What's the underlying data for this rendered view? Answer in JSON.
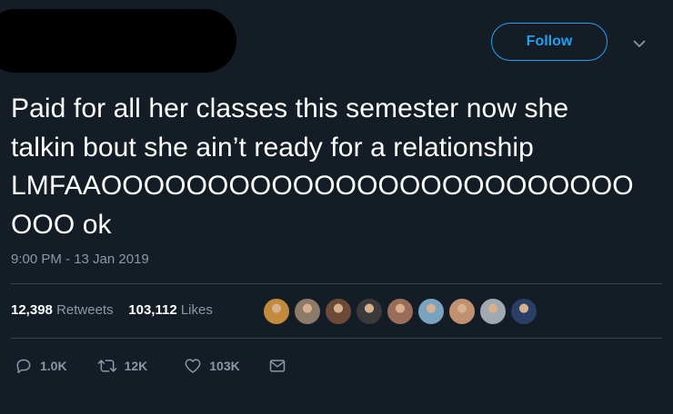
{
  "header": {
    "follow_label": "Follow"
  },
  "tweet": {
    "lines": [
      "Paid for all her classes this semester now she",
      "talkin bout she ain’t ready for a relationship",
      "LMFAAOOOOOOOOOOOOOOOOOOOOOOOOO",
      "OOO ok"
    ],
    "timestamp": "9:00 PM - 13 Jan 2019"
  },
  "stats": {
    "retweets_count": "12,398",
    "retweets_label": "Retweets",
    "likes_count": "103,112",
    "likes_label": "Likes"
  },
  "liker_avatars": [
    {
      "color": "#c28a3c"
    },
    {
      "color": "#8c7a6a"
    },
    {
      "color": "#6b4a3a"
    },
    {
      "color": "#3a3a3a"
    },
    {
      "color": "#9a6d5a"
    },
    {
      "color": "#7aa3c0"
    },
    {
      "color": "#c09070"
    },
    {
      "color": "#a0a8b0"
    },
    {
      "color": "#2a3f66"
    }
  ],
  "actions": {
    "reply_count": "1.0K",
    "retweet_count": "12K",
    "like_count": "103K"
  },
  "colors": {
    "background": "#141d26",
    "accent": "#1da1f2",
    "muted": "#8899a6",
    "divider": "#38444d"
  },
  "icons": [
    "chevron-down-icon",
    "reply-icon",
    "retweet-icon",
    "heart-icon",
    "envelope-icon"
  ]
}
